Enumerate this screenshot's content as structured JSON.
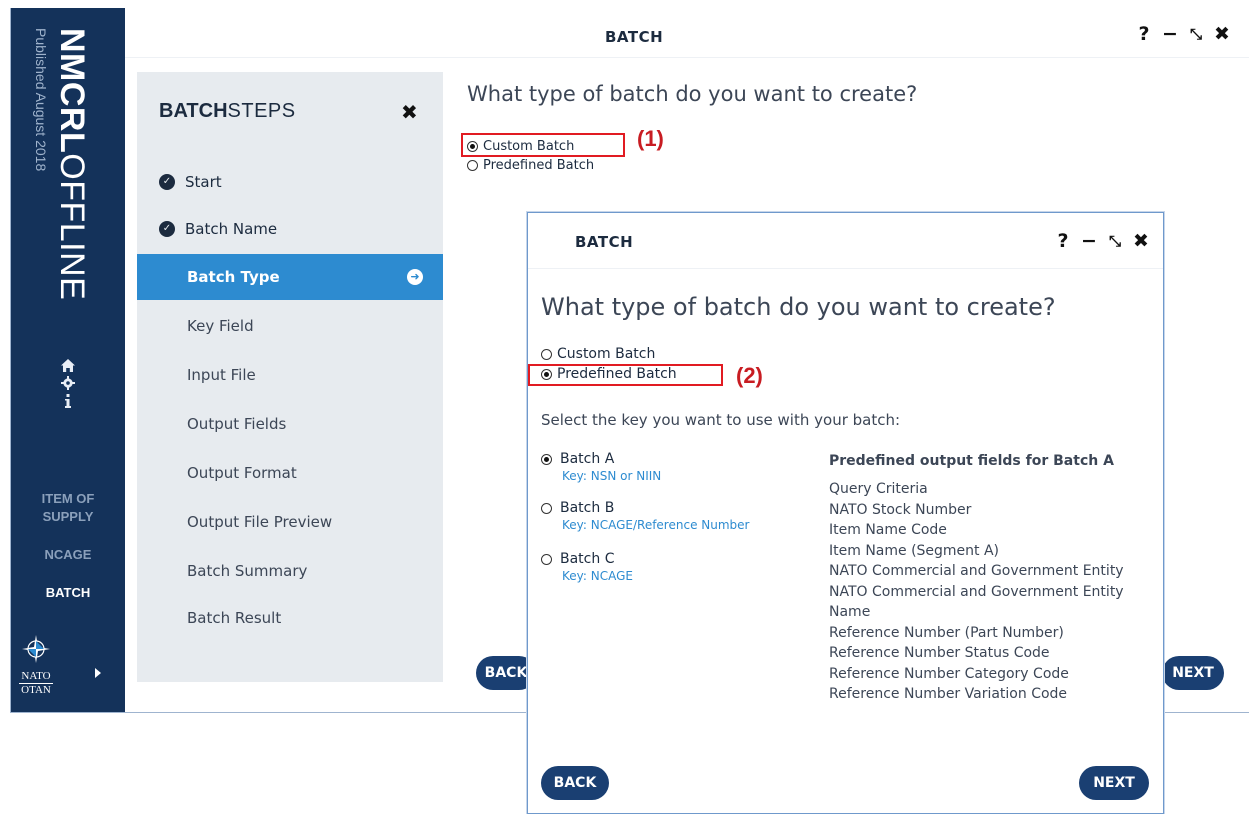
{
  "app": {
    "brand_bold": "NMCRL",
    "brand_light": "OFFLINE",
    "published": "Published August 2018",
    "rail_icons": [
      "home-icon",
      "gear-icon",
      "info-icon"
    ],
    "rail_nav": [
      {
        "label": "ITEM OF SUPPLY",
        "active": false
      },
      {
        "label": "NCAGE",
        "active": false
      },
      {
        "label": "BATCH",
        "active": true
      }
    ],
    "logo_text_top": "NATO",
    "logo_text_bottom": "OTAN"
  },
  "window": {
    "title": "BATCH",
    "controls": {
      "help": "?",
      "minimize": "−",
      "restore": "⤡",
      "close": "✖"
    }
  },
  "steps": {
    "header_bold": "BATCH",
    "header_light": "STEPS",
    "close": "✖",
    "items": [
      {
        "label": "Start",
        "state": "done"
      },
      {
        "label": "Batch Name",
        "state": "done"
      },
      {
        "label": "Batch Type",
        "state": "active"
      },
      {
        "label": "Key Field",
        "state": "pending"
      },
      {
        "label": "Input File",
        "state": "pending"
      },
      {
        "label": "Output Fields",
        "state": "pending"
      },
      {
        "label": "Output Format",
        "state": "pending"
      },
      {
        "label": "Output File Preview",
        "state": "pending"
      },
      {
        "label": "Batch Summary",
        "state": "pending"
      },
      {
        "label": "Batch Result",
        "state": "pending"
      }
    ]
  },
  "main": {
    "question": "What type of batch do you want to create?",
    "options": [
      {
        "label": "Custom Batch",
        "selected": true
      },
      {
        "label": "Predefined Batch",
        "selected": false
      }
    ],
    "callout": "(1)",
    "back": "BACK",
    "next": "NEXT"
  },
  "dialog": {
    "title": "BATCH",
    "question": "What type of batch do you want to create?",
    "options": [
      {
        "label": "Custom Batch",
        "selected": false
      },
      {
        "label": "Predefined Batch",
        "selected": true
      }
    ],
    "callout": "(2)",
    "subheading": "Select the key you want to use with your batch:",
    "batches": [
      {
        "name": "Batch A",
        "key": "Key: NSN or NIIN",
        "selected": true
      },
      {
        "name": "Batch B",
        "key": "Key: NCAGE/Reference Number",
        "selected": false
      },
      {
        "name": "Batch C",
        "key": "Key: NCAGE",
        "selected": false
      }
    ],
    "output_heading": "Predefined output fields for Batch A",
    "output_fields": [
      "Query Criteria",
      "NATO Stock Number",
      "Item Name Code",
      "Item Name (Segment A)",
      "NATO Commercial and Government Entity",
      "NATO Commercial and Government Entity Name",
      "Reference Number (Part Number)",
      "Reference Number Status Code",
      "Reference Number Category Code",
      "Reference Number Variation Code"
    ],
    "back": "BACK",
    "next": "NEXT"
  },
  "colors": {
    "rail": "#14325a",
    "active_step": "#2d8bd0",
    "button": "#1a3f72",
    "highlight": "#e11b22"
  }
}
